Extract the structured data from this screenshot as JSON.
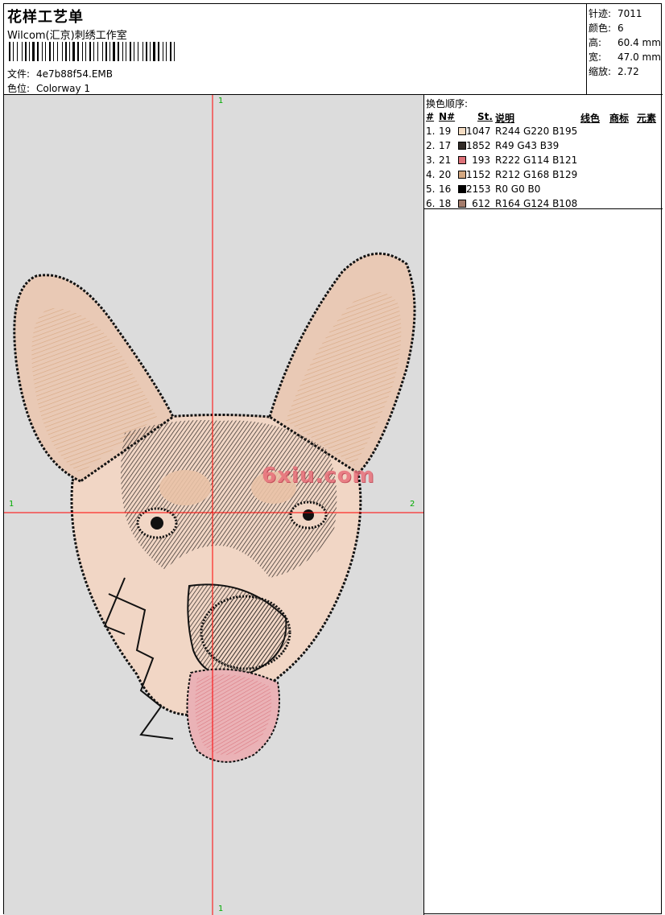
{
  "header": {
    "title": "花样工艺单",
    "company": "Wilcom(汇京)刺绣工作室",
    "file_label": "文件:",
    "file_value": "4e7b88f54.EMB",
    "colorway_label": "色位:",
    "colorway_value": "Colorway 1"
  },
  "stats": {
    "stitches_label": "针迹:",
    "stitches_value": "7011",
    "colors_label": "颜色:",
    "colors_value": "6",
    "height_label": "高:",
    "height_value": "60.4 mm",
    "width_label": "宽:",
    "width_value": "47.0 mm",
    "zoom_label": "缩放:",
    "zoom_value": "2.72"
  },
  "canvas": {
    "watermark": "6xiu.com",
    "axis_top": "1",
    "axis_left": "1",
    "axis_right": "2",
    "axis_bottom": "1"
  },
  "color_sequence": {
    "heading": "换色顺序:",
    "columns": {
      "hash": "#",
      "n": "N#",
      "st": "St.",
      "desc": "说明",
      "thread": "线色",
      "brand": "商标",
      "element": "元素"
    },
    "rows": [
      {
        "idx": "1.",
        "num": "19",
        "color": "#F4DCC3",
        "st": "1047",
        "desc": "R244 G220 B195"
      },
      {
        "idx": "2.",
        "num": "17",
        "color": "#312B27",
        "st": "1852",
        "desc": "R49 G43 B39"
      },
      {
        "idx": "3.",
        "num": "21",
        "color": "#DE7279",
        "st": "193",
        "desc": "R222 G114 B121"
      },
      {
        "idx": "4.",
        "num": "20",
        "color": "#D4A881",
        "st": "1152",
        "desc": "R212 G168 B129"
      },
      {
        "idx": "5.",
        "num": "16",
        "color": "#000000",
        "st": "2153",
        "desc": "R0 G0 B0"
      },
      {
        "idx": "6.",
        "num": "18",
        "color": "#A47C6C",
        "st": "612",
        "desc": "R164 G124 B108"
      }
    ]
  }
}
